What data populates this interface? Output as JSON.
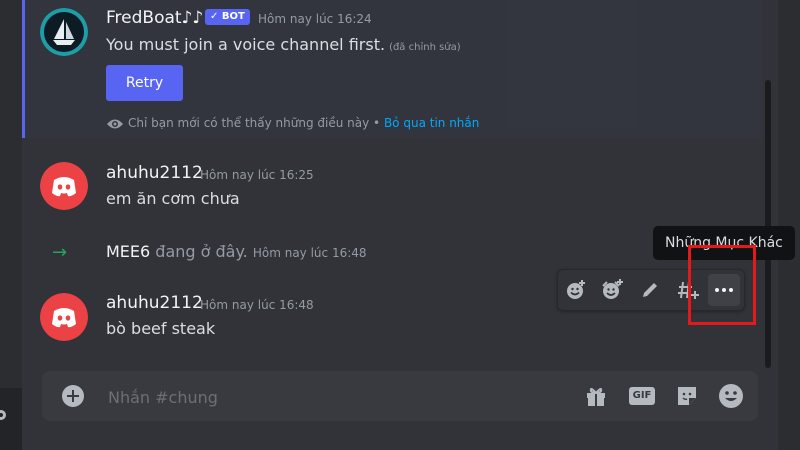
{
  "messages": [
    {
      "author": "FredBoat♪♪",
      "badge": "✓ BOT",
      "timestamp": "Hôm nay lúc 16:24",
      "text": "You must join a voice channel first.",
      "edited": "(đã chỉnh sửa)",
      "button": "Retry",
      "ephemeral_note": "Chỉ bạn mới có thể thấy những điều này",
      "separator": "•",
      "dismiss_link": "Bỏ qua tin nhắn",
      "avatar_icon": "fredboat-ship-icon"
    },
    {
      "author": "ahuhu2112",
      "timestamp": "Hôm nay lúc 16:25",
      "text": "em ăn cơm chưa",
      "avatar_icon": "discord-logo-icon"
    },
    {
      "join_arrow": "→",
      "author": "MEE6",
      "text": "đang ở đây.",
      "timestamp": "Hôm nay lúc 16:48"
    },
    {
      "author": "ahuhu2112",
      "timestamp": "Hôm nay lúc 16:48",
      "text": "bò beef steak",
      "avatar_icon": "discord-logo-icon"
    }
  ],
  "toolbar": {
    "tooltip": "Những Mục Khác",
    "actions": [
      "add-reaction-icon",
      "super-reaction-icon",
      "edit-icon",
      "create-thread-icon",
      "more-icon"
    ]
  },
  "composer": {
    "placeholder": "Nhắn #chung",
    "gif_label": "GIF"
  },
  "colors": {
    "background": "#313338",
    "accent": "#5865f2",
    "avatar_red": "#ed4245",
    "link": "#00a8fc",
    "highlight": "#e5191c",
    "join_green": "#23a55a"
  }
}
